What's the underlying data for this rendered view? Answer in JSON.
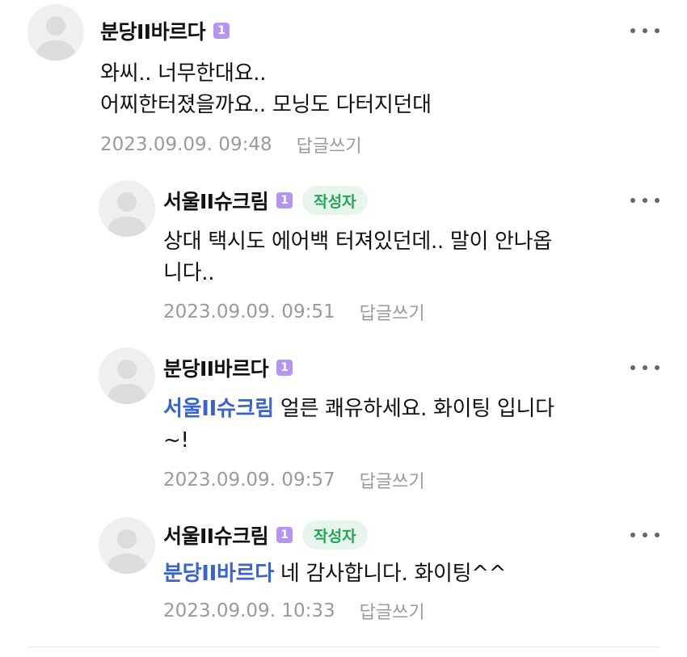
{
  "comments": [
    {
      "author": "분당II바르다",
      "level": "1",
      "writer_badge": "",
      "mention": "",
      "lines": [
        "와씨.. 너무한대요..",
        "어찌한터졌을까요.. 모닝도 다터지던대"
      ],
      "date": "2023.09.09. 09:48",
      "reply_label": "답글쓰기"
    },
    {
      "author": "서울II슈크림",
      "level": "1",
      "writer_badge": "작성자",
      "mention": "",
      "lines": [
        "상대 택시도 에어백 터져있던데.. 말이 안나옵",
        "니다.."
      ],
      "date": "2023.09.09. 09:51",
      "reply_label": "답글쓰기"
    },
    {
      "author": "분당II바르다",
      "level": "1",
      "writer_badge": "",
      "mention": "서울II슈크림",
      "lines": [
        " 얼른 쾌유하세요. 화이팅 입니다",
        "~!"
      ],
      "date": "2023.09.09. 09:57",
      "reply_label": "답글쓰기"
    },
    {
      "author": "서울II슈크림",
      "level": "1",
      "writer_badge": "작성자",
      "mention": "분당II바르다",
      "lines": [
        " 네 감사합니다. 화이팅^^"
      ],
      "date": "2023.09.09. 10:33",
      "reply_label": "답글쓰기"
    }
  ],
  "icons": {
    "avatar": "default-profile-icon",
    "more": "more-options-icon"
  },
  "colors": {
    "mention": "#3a64c8",
    "level_badge": "#b794f0",
    "writer_badge_bg": "#e6f6ec",
    "writer_badge_text": "#27a455",
    "meta": "#9a9a9a"
  }
}
